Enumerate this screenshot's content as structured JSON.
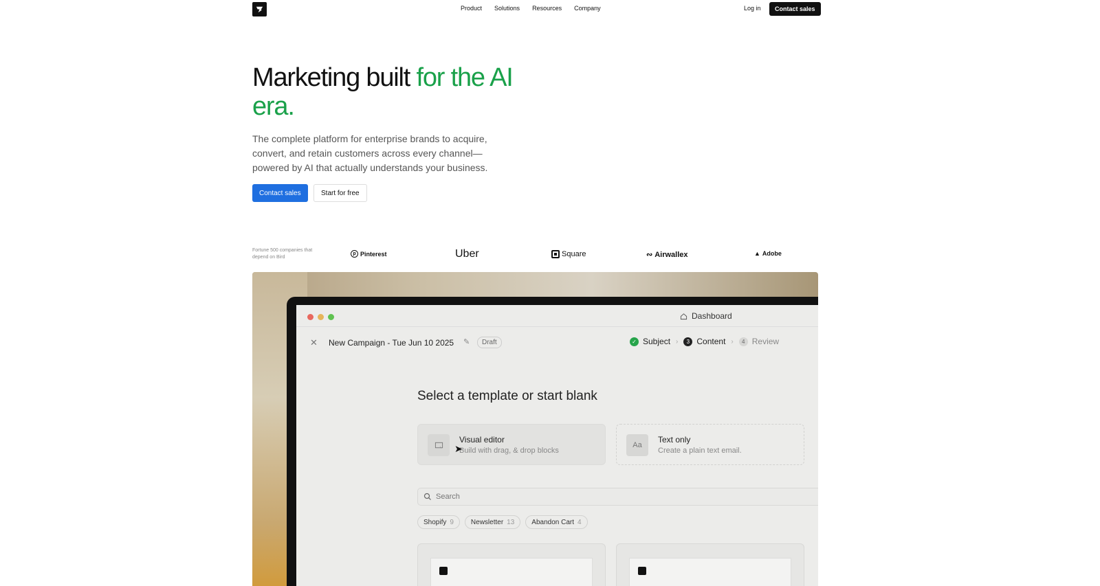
{
  "nav": {
    "links": [
      "Product",
      "Solutions",
      "Resources",
      "Company"
    ],
    "login": "Log in",
    "cta": "Contact sales"
  },
  "hero": {
    "title_dark": "Marketing built ",
    "title_green": "for the AI era.",
    "subtitle": "The complete platform for enterprise brands to acquire, convert, and retain customers across every channel—powered by AI that actually understands your business.",
    "primary_button": "Contact sales",
    "secondary_button": "Start for free"
  },
  "logos": {
    "caption": "Fortune 500 companies that depend on Bird",
    "brands": [
      "Pinterest",
      "Uber",
      "Square",
      "Airwallex",
      "Adobe"
    ]
  },
  "app": {
    "window_title": "Dashboard",
    "campaign_name": "New Campaign - Tue Jun 10 2025",
    "status": "Draft",
    "steps": [
      {
        "label": "Subject",
        "marker": "✓"
      },
      {
        "label": "Content",
        "marker": "3"
      },
      {
        "label": "Review",
        "marker": "4"
      }
    ],
    "panel_title": "Select a template or start blank",
    "cards": [
      {
        "title": "Visual editor",
        "desc": "Build with drag, & drop blocks",
        "icon": "visual-editor-icon"
      },
      {
        "title": "Text only",
        "desc": "Create a plain text email.",
        "icon_text": "Aa"
      }
    ],
    "search_placeholder": "Search",
    "chips": [
      {
        "label": "Shopify",
        "count": "9"
      },
      {
        "label": "Newsletter",
        "count": "13"
      },
      {
        "label": "Abandon Cart",
        "count": "4"
      }
    ]
  },
  "colors": {
    "accent_green": "#1aa14a",
    "primary_blue": "#1f6fe0",
    "dark": "#111111"
  }
}
